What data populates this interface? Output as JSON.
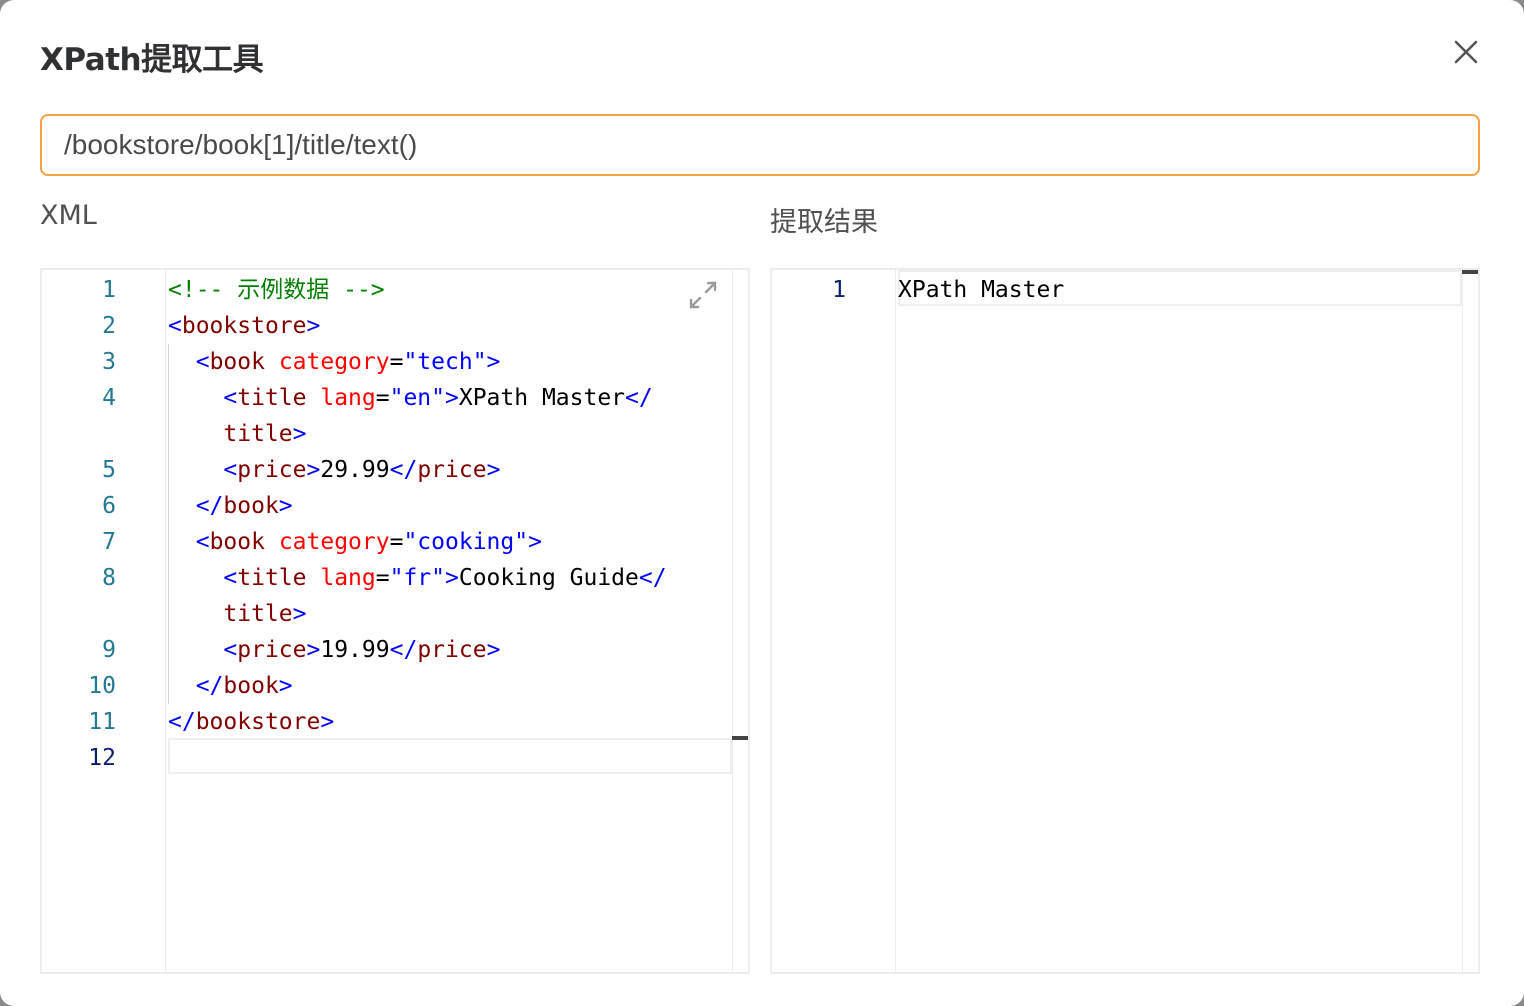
{
  "dialog": {
    "title": "XPath提取工具",
    "close_icon": "close-icon"
  },
  "xpath": {
    "value": "/bookstore/book[1]/title/text()"
  },
  "xml_pane": {
    "label": "XML",
    "expand_icon": "expand-icon",
    "line_numbers": [
      "1",
      "2",
      "3",
      "4",
      "5",
      "6",
      "7",
      "8",
      "9",
      "10",
      "11",
      "12"
    ],
    "active_line": "12",
    "code": {
      "l1_comment": "<!-- 示例数据 -->",
      "l2_open": "<",
      "l2_tag": "bookstore",
      "l2_close": ">",
      "l3_open": "<",
      "l3_tag": "book",
      "l3_attr": "category",
      "l3_eq": "=",
      "l3_val": "\"tech\"",
      "l3_close": ">",
      "l4_open": "<",
      "l4_tag": "title",
      "l4_attr": "lang",
      "l4_eq": "=",
      "l4_val": "\"en\"",
      "l4_close": ">",
      "l4_text": "XPath Master",
      "l4_end_open": "</",
      "l4_wrap_tag": "title",
      "l4_wrap_close": ">",
      "l5_open": "<",
      "l5_tag": "price",
      "l5_close": ">",
      "l5_text": "29.99",
      "l5_end_open": "</",
      "l5_end_tag": "price",
      "l5_end_close": ">",
      "l6_end_open": "</",
      "l6_end_tag": "book",
      "l6_end_close": ">",
      "l7_open": "<",
      "l7_tag": "book",
      "l7_attr": "category",
      "l7_eq": "=",
      "l7_val": "\"cooking\"",
      "l7_close": ">",
      "l8_open": "<",
      "l8_tag": "title",
      "l8_attr": "lang",
      "l8_eq": "=",
      "l8_val": "\"fr\"",
      "l8_close": ">",
      "l8_text": "Cooking Guide",
      "l8_end_open": "</",
      "l8_wrap_tag": "title",
      "l8_wrap_close": ">",
      "l9_open": "<",
      "l9_tag": "price",
      "l9_close": ">",
      "l9_text": "19.99",
      "l9_end_open": "</",
      "l9_end_tag": "price",
      "l9_end_close": ">",
      "l10_end_open": "</",
      "l10_end_tag": "book",
      "l10_end_close": ">",
      "l11_end_open": "</",
      "l11_end_tag": "bookstore",
      "l11_end_close": ">"
    }
  },
  "result_pane": {
    "label": "提取结果",
    "line_numbers": [
      "1"
    ],
    "lines": [
      "XPath Master"
    ]
  }
}
